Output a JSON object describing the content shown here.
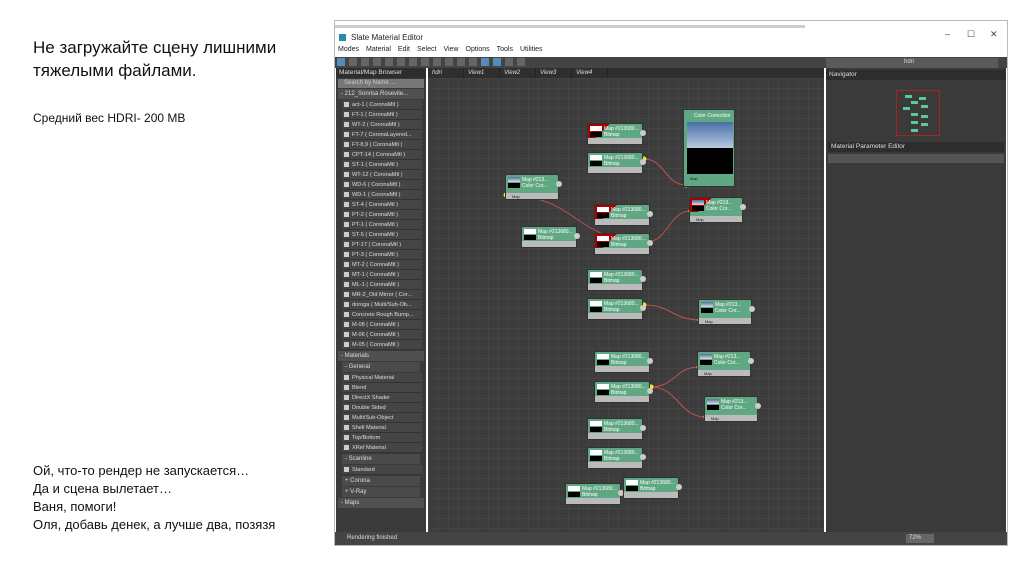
{
  "slide": {
    "heading": "Не загружайте сцену лишними тяжелыми файлами.",
    "subheading": "Средний вес HDRI- 200 MB",
    "story": [
      "Ой, что-то рендер не запускается…",
      "Да и сцена вылетает…",
      "Ваня, помоги!",
      "Оля, добавь денек, а лучше два, позязя"
    ]
  },
  "window": {
    "title": "Slate Material Editor",
    "controls": [
      "–",
      "☐",
      "✕"
    ],
    "menu": [
      "Modes",
      "Material",
      "Edit",
      "Select",
      "View",
      "Options",
      "Tools",
      "Utilities"
    ],
    "view_select": "hdri",
    "tabs": [
      "hdri",
      "View1",
      "View2",
      "View3",
      "View4"
    ],
    "browser": {
      "title": "Material/Map Browser",
      "search_placeholder": "Search by Name ...",
      "scene": "- 212_Sonrisa Rosevile...",
      "scene_items": [
        "act-1 ( CoronaMtl )",
        "FT-1 ( CoronaMtl )",
        "WT-2 ( CoronaMtl )",
        "FT-7 ( CoronaLayered...",
        "FT-8,9 ( CoronaMtl )",
        "CPT-14 ( CoronaMtl )",
        "ST-1 ( CoronaMtl )",
        "WT-12 ( CoronaMtl )",
        "WD-6 ( CoronaMtl )",
        "WD-1 ( CoronaMtl )",
        "ST-4 ( CoronaMtl )",
        "PT-2 ( CoronaMtl )",
        "PT-1 ( CoronaMtl )",
        "ST-5 ( CoronaMtl )",
        "PT-17 ( CoronaMtl )",
        "PT-3 ( CoronaMtl )",
        "MT-2 ( CoronaMtl )",
        "MT-1 ( CoronaMtl )",
        "ML-1 ( CoronaMtl )",
        "MR-2_Old Mirror ( Cor...",
        "doroga ( Multi/Sub-Ob...",
        "Concrete Rough Bump...",
        "M-08 ( CoronaMtl )",
        "M-06 ( CoronaMtl )",
        "M-05 ( CoronaMtl )"
      ],
      "materials": "- Materials",
      "general": "- General",
      "general_items": [
        "Physical Material",
        "Blend",
        "DirectX Shader",
        "Double Sided",
        "Multi/Sub-Object",
        "Shell Material",
        "Top/Bottom",
        "XRef Material"
      ],
      "scanline": "- Scanline",
      "scanline_items": [
        "Standard"
      ],
      "corona": "+ Corona",
      "vray": "+ V-Ray",
      "maps": "- Maps"
    },
    "navigator": "Navigator",
    "param_editor": "Material Parameter Editor",
    "status": "Rendering finished",
    "zoom": "72%",
    "nodes": {
      "bitmap_title": "Map #213680...",
      "bitmap_sub": "Bitmap",
      "cc_title": "Map #213...",
      "cc_sub": "Color Cor...",
      "cc_big": "Color Correction",
      "socket": "Map"
    }
  }
}
